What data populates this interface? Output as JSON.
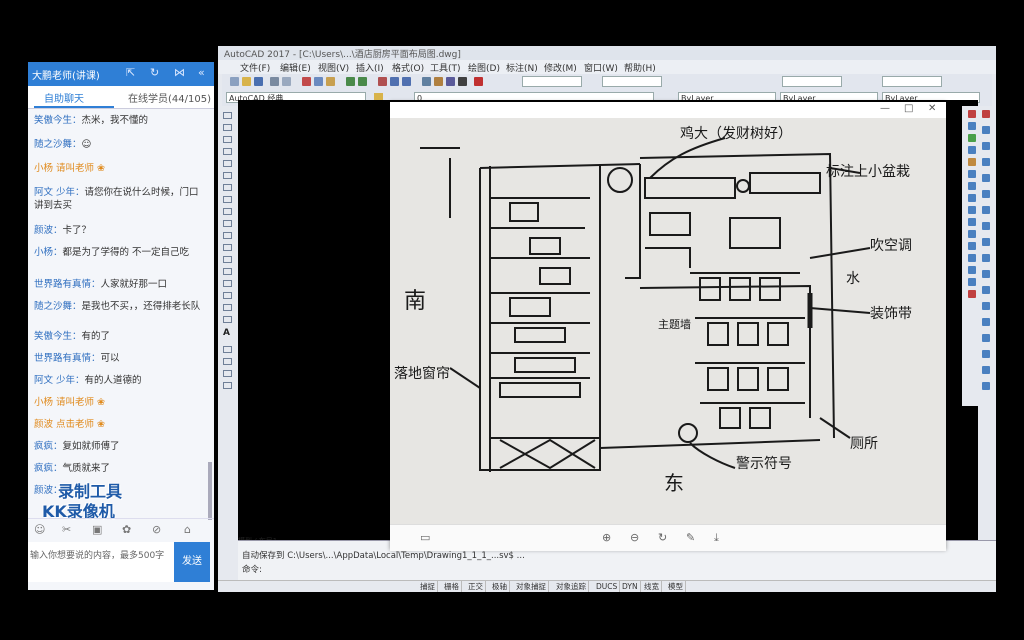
{
  "chat": {
    "title": "大鹏老师(讲课)",
    "tabs": [
      "自助聊天",
      "在线学员(44/105)"
    ],
    "messages": [
      {
        "name": "笑傲今生：",
        "text": "杰米，我不懂的",
        "color": "blue"
      },
      {
        "name": "随之沙舞：",
        "text": "☺",
        "color": "blue"
      },
      {
        "name": "小杨 请叫老师",
        "text": "",
        "color": "orange"
      },
      {
        "name": "阿文 少年：",
        "text": "请您你在说什么时候，门口讲到去买",
        "color": "blue"
      },
      {
        "name": "颜波：",
        "text": "卡了？",
        "color": "blue"
      },
      {
        "name": "小杨：",
        "text": "都是为了学得的 不一定自己吃",
        "color": "blue"
      },
      {
        "name": "世界路有真情：",
        "text": "人家就好那一口",
        "color": "blue"
      },
      {
        "name": "随之沙舞：",
        "text": "是我也不买，，还得排老长队",
        "color": "blue"
      },
      {
        "name": "笑傲今生：",
        "text": "有的了",
        "color": "blue"
      },
      {
        "name": "世界路有真情：",
        "text": "可以",
        "color": "blue"
      },
      {
        "name": "阿文 少年：",
        "text": "有的人道德的",
        "color": "blue"
      },
      {
        "name": "小杨 请叫老师",
        "text": "",
        "color": "orange"
      },
      {
        "name": "颜波 点击老师",
        "text": "",
        "color": "orange"
      },
      {
        "name": "疯疯：",
        "text": "复如就师傅了",
        "color": "blue"
      },
      {
        "name": "疯疯：",
        "text": "气质就来了",
        "color": "blue"
      },
      {
        "name": "颜波：",
        "text": "",
        "color": "blue"
      }
    ],
    "watermark": [
      "录制工具",
      "KK录像机"
    ],
    "input_placeholder": "输入你想要说的内容，最多500字",
    "send_label": "发送"
  },
  "cad": {
    "title": "AutoCAD 2017 - [C:\\Users\\...\\酒店厨房平面布局图.dwg]",
    "menu": [
      "文件(F)",
      "编辑(E)",
      "视图(V)",
      "插入(I)",
      "格式(O)",
      "工具(T)",
      "绘图(D)",
      "标注(N)",
      "修改(M)",
      "窗口(W)",
      "帮助(H)"
    ],
    "workspace": "AutoCAD 经典",
    "layer_combo": "0",
    "bylayer": [
      "ByLayer",
      "ByLayer",
      "ByLayer"
    ],
    "layout_tabs": "模型 / 布局1",
    "cmd_lines": [
      "自动保存到 C:\\Users\\...\\AppData\\Local\\Temp\\Drawing1_1_1_...sv$ ...",
      "命令:"
    ],
    "status_items": [
      "捕捉",
      "栅格",
      "正交",
      "极轴",
      "对象捕捉",
      "对象追踪",
      "DUCS",
      "DYN",
      "线宽",
      "模型"
    ]
  },
  "viewer": {
    "sketch_labels": {
      "top": "鸡大（发财树好）",
      "right_top": "标注上小盆栽",
      "right1": "吹空调",
      "right2": "水",
      "right3": "装饰带",
      "left1": "南",
      "left2": "落地窗帘",
      "bottom_left": "东",
      "bottom_mid": "警示符号",
      "bottom_right": "厕所",
      "small_left": "主题墙"
    }
  }
}
